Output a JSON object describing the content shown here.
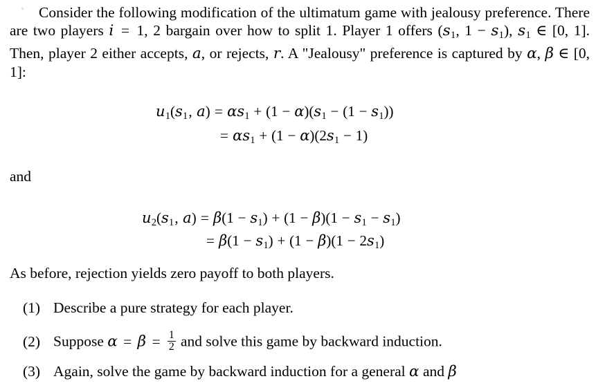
{
  "document": {
    "type": "math-problem-statement",
    "background_color": "#ffffff",
    "text_color": "#000000",
    "paragraph1": {
      "full_text": "Consider the following modification of the ultimatum game with jealousy preference. There are two players i = 1, 2 bargain over how to split 1. Player 1 offers (s1, 1 − s1), s1 ∈ [0, 1]. Then, player 2 either accepts, a, or rejects, r. A \"Jealousy\" preference is captured by α, β ∈ [0, 1]:",
      "segments": {
        "s1": "Consider the following modification of the ultimatum game with jealousy preference. There are two players ",
        "s2": "i",
        "s3": " = ",
        "s4": "1, 2",
        "s5": " bargain over how to split 1. Player 1 offers (",
        "s6": "s",
        "s7": "1",
        "s8": ", 1 − ",
        "s9": "), ",
        "s10": " ∈ [0, 1]. Then, player 2 either accepts, ",
        "s11": "a",
        "s12": ", or rejects, ",
        "s13": "r",
        "s14": ". A \"Jealousy\" preference is captured by ",
        "s15": "α",
        "s16": ", ",
        "s17": "β",
        "s18": " ∈ [0, 1]:"
      }
    },
    "equation_block_1": {
      "line1": "u₁(s₁, a) = αs₁ + (1 − α)(s₁ − (1 − s₁))",
      "line2": "= αs₁ + (1 − α)(2s₁ − 1)",
      "parts": {
        "u": "u",
        "u_sub": "1",
        "open": "(",
        "s": "s",
        "s_sub": "1",
        "comma": ", ",
        "a": "a",
        "close": ")",
        "equals": "=",
        "alpha": "α",
        "plus": "+",
        "minus": "−",
        "one": "1",
        "two": "2"
      }
    },
    "and_label": "and",
    "equation_block_2": {
      "line1": "u₂(s₁, a) = β(1 − s₁) + (1 − β)(1 − s₁ − s₁)",
      "line2": "= β(1 − s₁) + (1 − β)(1 − 2s₁)",
      "parts": {
        "u": "u",
        "u_sub": "2",
        "open": "(",
        "s": "s",
        "s_sub": "1",
        "comma": ", ",
        "a": "a",
        "close": ")",
        "equals": "=",
        "beta": "β",
        "plus": "+",
        "minus": "−",
        "one": "1",
        "two": "2"
      }
    },
    "paragraph2": "As before, rejection yields zero payoff to both players.",
    "list": {
      "item1": {
        "marker": "(1)",
        "text": "Describe a pure strategy for each player."
      },
      "item2": {
        "marker": "(2)",
        "text_before": "Suppose ",
        "alpha": "α",
        "eq1": " = ",
        "beta": "β",
        "eq2": " = ",
        "frac_num": "1",
        "frac_den": "2",
        "text_after": " and solve this game by backward induction.",
        "full_text": "Suppose α = β = 1/2 and solve this game by backward induction."
      },
      "item3": {
        "marker": "(3)",
        "text_before": "Again, solve the game by backward induction for a general ",
        "alpha": "α",
        "text_mid": " and ",
        "beta": "β",
        "full_text": "Again, solve the game by backward induction for a general α and β"
      }
    }
  }
}
